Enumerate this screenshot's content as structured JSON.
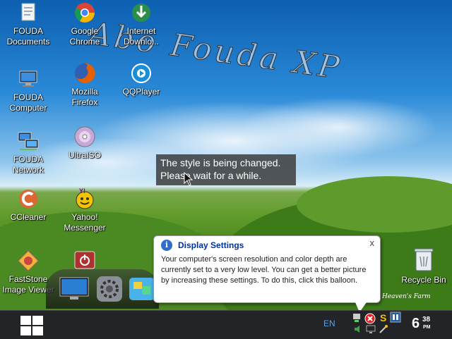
{
  "desktop": {
    "watermark": "Abo Fouda XP",
    "icons": [
      {
        "label": "FOUDA\nDocuments",
        "icon": "documents-icon"
      },
      {
        "label": "Google\nChrome",
        "icon": "chrome-icon"
      },
      {
        "label": "Internet\nDownlo...",
        "icon": "idm-icon"
      },
      {
        "label": "FOUDA\nComputer",
        "icon": "computer-icon"
      },
      {
        "label": "Mozilla Firefox",
        "icon": "firefox-icon"
      },
      {
        "label": "QQPlayer",
        "icon": "qqplayer-icon"
      },
      {
        "label": "FOUDA\nNetwork",
        "icon": "network-icon"
      },
      {
        "label": "UltraISO",
        "icon": "ultraiso-icon"
      },
      {
        "label": "CCleaner",
        "icon": "ccleaner-icon"
      },
      {
        "label": "Yahoo!\nMessenger",
        "icon": "yahoo-messenger-icon"
      },
      {
        "label": "FastStone\nImage Viewer",
        "icon": "faststone-icon"
      }
    ],
    "recycle_bin": "Recycle Bin",
    "wallpaper_caption": "Heaven's Farm"
  },
  "tooltip": {
    "line1": "The style is being changed.",
    "line2": "Please wait for a while."
  },
  "balloon": {
    "title": "Display Settings",
    "body": "Your computer's screen resolution and color depth are currently set to a very low level. You can get a better picture by increasing these settings. To do this, click this balloon.",
    "close": "x"
  },
  "taskbar": {
    "language": "EN",
    "clock_hour": "6",
    "clock_minute": "38",
    "clock_ampm": "PM"
  },
  "colors": {
    "taskbar": "#222428",
    "balloon_title": "#003399",
    "language": "#4aa8ff"
  }
}
